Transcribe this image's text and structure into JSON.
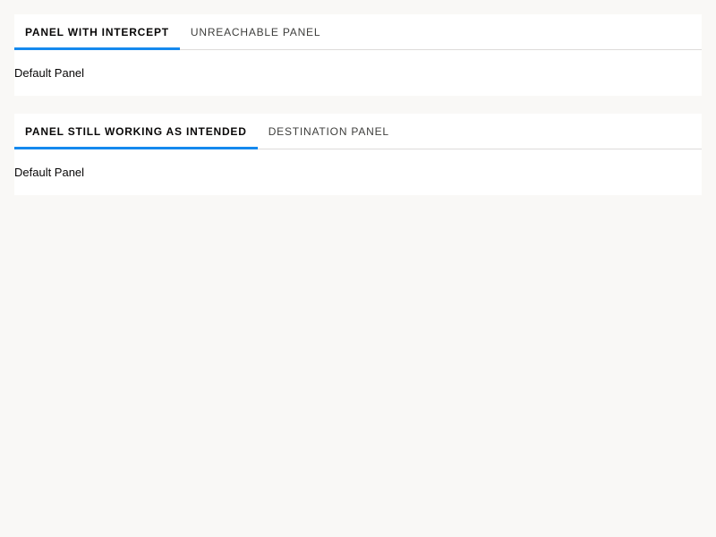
{
  "tabsets": [
    {
      "tabs": [
        {
          "label": "PANEL WITH INTERCEPT",
          "active": true
        },
        {
          "label": "UNREACHABLE PANEL",
          "active": false
        }
      ],
      "panel_text": "Default Panel"
    },
    {
      "tabs": [
        {
          "label": "PANEL STILL WORKING AS INTENDED",
          "active": true
        },
        {
          "label": "DESTINATION PANEL",
          "active": false
        }
      ],
      "panel_text": "Default Panel"
    }
  ],
  "colors": {
    "page_background": "#f9f8f6",
    "card_background": "#ffffff",
    "active_indicator": "#1589ee",
    "divider": "#dddbda"
  }
}
